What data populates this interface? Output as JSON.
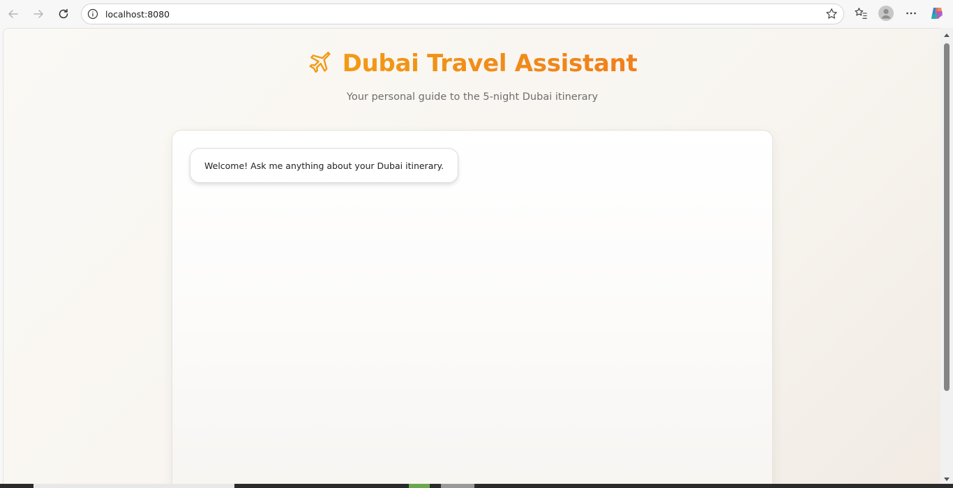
{
  "browser": {
    "url": "localhost:8080"
  },
  "page": {
    "title": "Dubai Travel Assistant",
    "subtitle": "Your personal guide to the 5-night Dubai itinerary",
    "title_icon": "airplane-icon"
  },
  "chat": {
    "messages": [
      {
        "role": "assistant",
        "text": "Welcome! Ask me anything about your Dubai itinerary."
      }
    ]
  },
  "colors": {
    "accent_start": "#f29a15",
    "accent_end": "#f07f1c",
    "subtitle": "#6e6e6e"
  }
}
